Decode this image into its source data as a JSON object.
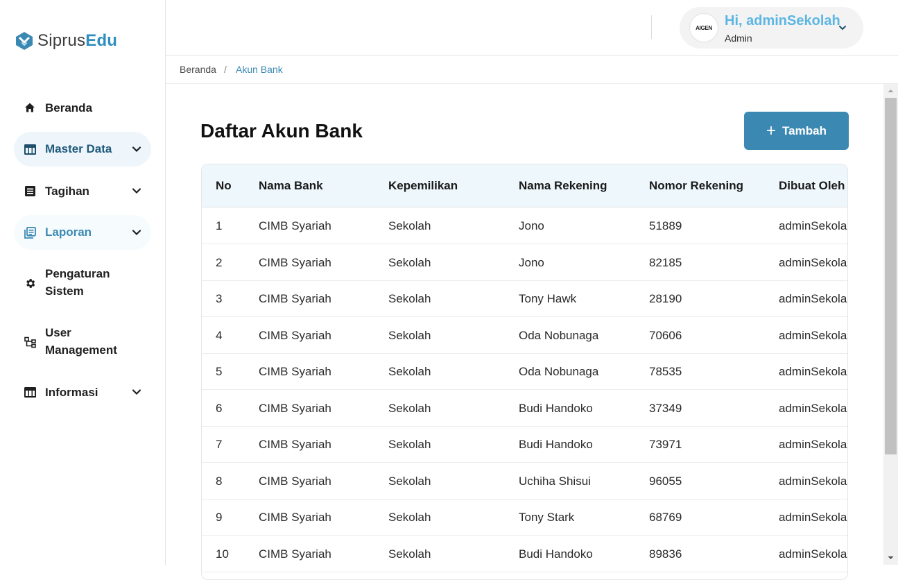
{
  "brand": {
    "part1": "Siprus",
    "part2": "Edu"
  },
  "sidebar": {
    "items": [
      {
        "label": "Beranda",
        "icon": "home-icon"
      },
      {
        "label": "Master Data",
        "icon": "table-icon"
      },
      {
        "label": "Tagihan",
        "icon": "list-icon"
      },
      {
        "label": "Laporan",
        "icon": "report-icon"
      },
      {
        "label": "Pengaturan\nSistem",
        "icon": "gear-icon"
      },
      {
        "label": "User\nManagement",
        "icon": "hierarchy-icon"
      },
      {
        "label": "Informasi",
        "icon": "table-icon"
      }
    ]
  },
  "user": {
    "greeting": "Hi, adminSekolah",
    "role": "Admin",
    "avatar_text": "AIGEN"
  },
  "breadcrumb": {
    "home": "Beranda",
    "separator": "/",
    "current": "Akun Bank"
  },
  "main": {
    "title": "Daftar Akun Bank",
    "add_button": "Tambah",
    "table": {
      "headers": [
        "No",
        "Nama Bank",
        "Kepemilikan",
        "Nama Rekening",
        "Nomor Rekening",
        "Dibuat Oleh"
      ],
      "rows": [
        [
          "1",
          "CIMB Syariah",
          "Sekolah",
          "Jono",
          "51889",
          "adminSekolah"
        ],
        [
          "2",
          "CIMB Syariah",
          "Sekolah",
          "Jono",
          "82185",
          "adminSekolah"
        ],
        [
          "3",
          "CIMB Syariah",
          "Sekolah",
          "Tony Hawk",
          "28190",
          "adminSekolah"
        ],
        [
          "4",
          "CIMB Syariah",
          "Sekolah",
          "Oda Nobunaga",
          "70606",
          "adminSekolah"
        ],
        [
          "5",
          "CIMB Syariah",
          "Sekolah",
          "Oda Nobunaga",
          "78535",
          "adminSekolah"
        ],
        [
          "6",
          "CIMB Syariah",
          "Sekolah",
          "Budi Handoko",
          "37349",
          "adminSekolah"
        ],
        [
          "7",
          "CIMB Syariah",
          "Sekolah",
          "Budi Handoko",
          "73971",
          "adminSekolah"
        ],
        [
          "8",
          "CIMB Syariah",
          "Sekolah",
          "Uchiha Shisui",
          "96055",
          "adminSekolah"
        ],
        [
          "9",
          "CIMB Syariah",
          "Sekolah",
          "Tony Stark",
          "68769",
          "adminSekolah"
        ],
        [
          "10",
          "CIMB Syariah",
          "Sekolah",
          "Budi Handoko",
          "89836",
          "adminSekolah"
        ]
      ]
    }
  },
  "colors": {
    "accent": "#3b89b3",
    "greeting": "#5bb6e3",
    "header_bg": "#eef7fc"
  }
}
